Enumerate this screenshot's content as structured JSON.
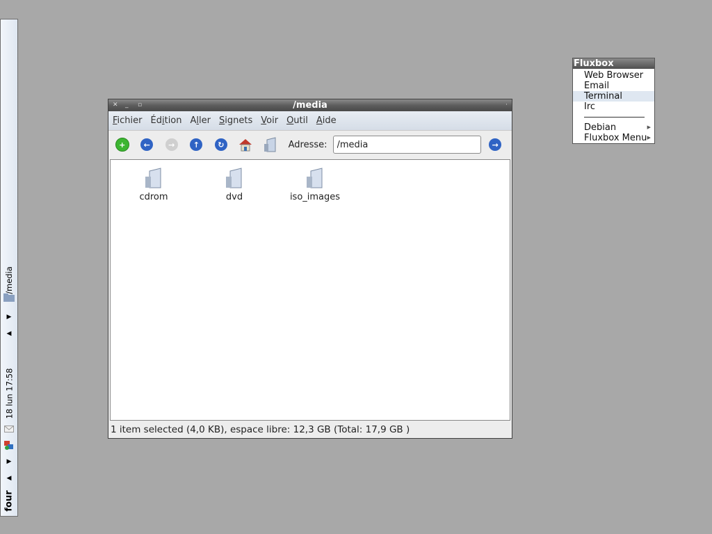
{
  "toolbar": {
    "workspace": "four",
    "clock": "18 lun 17:58",
    "task": "/media"
  },
  "window": {
    "title": "/media",
    "menus": [
      {
        "u": "F",
        "rest": "ichier"
      },
      {
        "pre": "Éd",
        "u": "i",
        "rest": "tion"
      },
      {
        "pre": "A",
        "u": "l",
        "rest": "ler"
      },
      {
        "u": "S",
        "rest": "ignets"
      },
      {
        "u": "V",
        "rest": "oir"
      },
      {
        "u": "O",
        "rest": "util"
      },
      {
        "u": "A",
        "rest": "ide"
      }
    ],
    "address_label": "Adresse:",
    "address_value": "/media",
    "items": [
      {
        "label": "cdrom"
      },
      {
        "label": "dvd"
      },
      {
        "label": "iso_images"
      }
    ],
    "status": "1 item selected (4,0 KB), espace libre:  12,3 GB (Total:  17,9 GB )"
  },
  "fluxbox_menu": {
    "title": "Fluxbox",
    "items": [
      "Web Browser",
      "Email",
      "Terminal",
      "Irc"
    ],
    "submenus": [
      "Debian",
      "Fluxbox Menu"
    ]
  },
  "colors": {
    "desktop": "#a8a8a8",
    "titlebar": "#5a5a5a",
    "menubar": "#dfe6ef",
    "highlight": "#dfe7f1",
    "go_button": "#2f63c4",
    "add_button": "#3cb531"
  },
  "icons": [
    "add-icon",
    "back-icon",
    "forward-icon",
    "up-icon",
    "reload-icon",
    "home-icon",
    "drives-icon",
    "go-icon",
    "folder-icon",
    "arrow-up-icon",
    "arrow-down-icon",
    "mail-icon",
    "network-icon"
  ]
}
